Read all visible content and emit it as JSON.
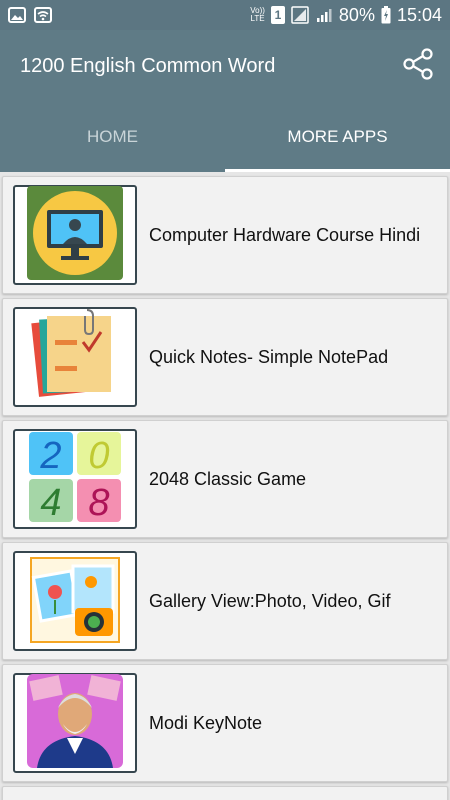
{
  "status_bar": {
    "volte_top": "Vo))",
    "volte_bottom": "LTE",
    "sim_number": "1",
    "battery": "80%",
    "time": "15:04"
  },
  "app_bar": {
    "title": "1200 English Common Word",
    "share_icon": "share-icon"
  },
  "tabs": [
    {
      "label": "HOME",
      "active": false
    },
    {
      "label": "MORE APPS",
      "active": true
    }
  ],
  "apps": [
    {
      "name": "Computer Hardware Course Hindi",
      "icon": "computer-user-icon"
    },
    {
      "name": "Quick Notes- Simple NotePad",
      "icon": "notes-icon"
    },
    {
      "name": "2048 Classic Game",
      "icon": "game-2048-icon",
      "tiles": [
        "2",
        "0",
        "4",
        "8"
      ]
    },
    {
      "name": "Gallery View:Photo, Video, Gif",
      "icon": "gallery-icon"
    },
    {
      "name": "Modi KeyNote",
      "icon": "modi-portrait-icon"
    }
  ],
  "colors": {
    "primary": "#5f7b86",
    "status_bar": "#5c7682",
    "list_bg": "#f2f2f2",
    "thumb_border": "#37474f"
  }
}
